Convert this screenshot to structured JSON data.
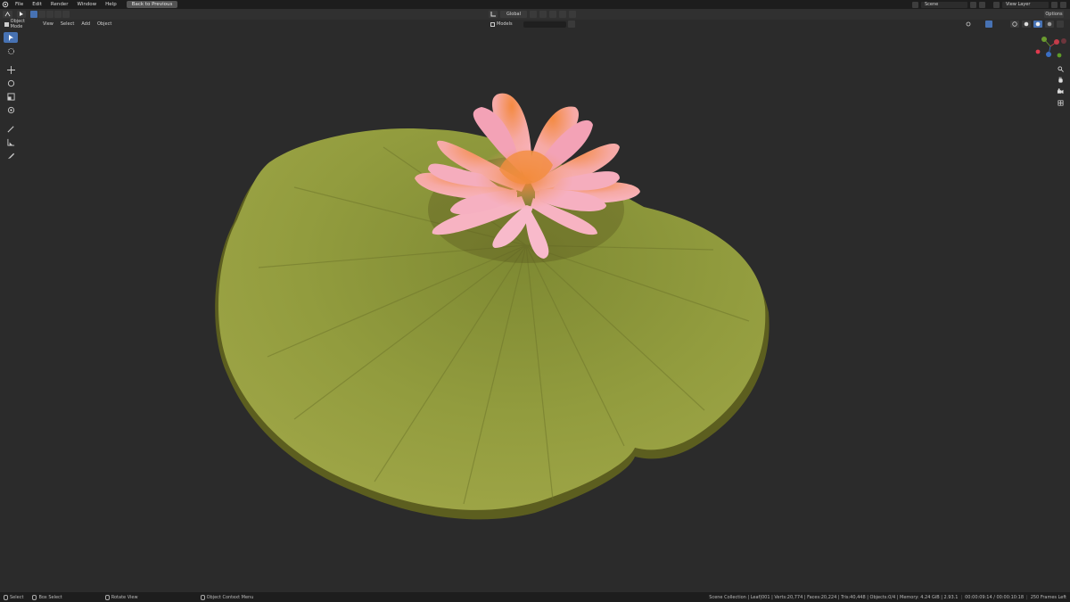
{
  "topbar": {
    "menus": [
      "File",
      "Edit",
      "Render",
      "Window",
      "Help"
    ],
    "back_button": "Back to Previous",
    "scene_label": "Scene",
    "view_layer_label": "View Layer"
  },
  "viewport_header": {
    "transform_orientation": "Global",
    "options_label": "Options",
    "mode_label": "Object Mode",
    "menus": [
      "View",
      "Select",
      "Add",
      "Object"
    ],
    "collection_label": "Models",
    "search_placeholder": ""
  },
  "toolbar": {
    "tools": [
      "select-box-tool",
      "cursor-tool",
      "move-tool",
      "rotate-tool",
      "scale-tool",
      "transform-tool",
      "annotate-tool",
      "measure-tool",
      "edit-tool"
    ]
  },
  "statusbar": {
    "select_label": "Select",
    "box_select_label": "Box Select",
    "rotate_label": "Rotate View",
    "context_label": "Object Context Menu",
    "stats": "Scene Collection | Leaf|001 | Verts:20,774 | Faces:20,224 | Tris:40,448 | Objects:0/4 | Memory: 4.24 GiB | 2.93.1",
    "time": "00:00:09:14 / 00:00:10:18",
    "frames": "250 Frames Left"
  },
  "colors": {
    "accent": "#4772b3",
    "viewport_bg": "#2b2b2b",
    "leaf": "#8f9a3c",
    "petal": "#f4a8b8",
    "petal_center": "#f7933f"
  }
}
